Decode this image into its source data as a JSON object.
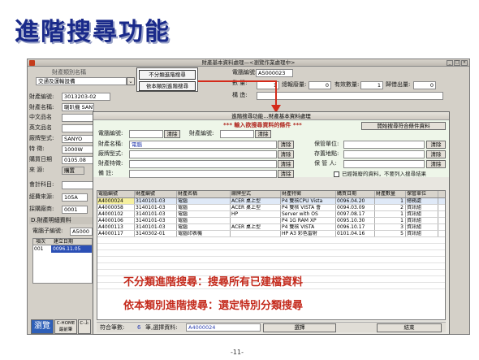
{
  "slide": {
    "title": "進階搜尋功能",
    "page_number": "-11-"
  },
  "back_window": {
    "title": "財產基本資料處理—<瀏覽作業處理中>",
    "category_label": "財產類別名稱",
    "category_value": "交通及運輸設備",
    "popup_options": [
      "不分類進階搜尋",
      "依本類別進階搜尋"
    ],
    "computer_no_label": "電腦編號:",
    "computer_no_value": "A5000023",
    "qty_label": "數 量:",
    "qty_value": "1",
    "total_qty_label": "總報廢量:",
    "total_qty_value": "0",
    "valid_qty_label": "有效數量:",
    "valid_qty_value": "1",
    "returned_label": "歸借出量:",
    "returned_value": "0",
    "build_label": "構 造:",
    "asset_no_label": "財產編號:",
    "asset_no_value": "3013203-02",
    "asset_name_label": "財產名稱:",
    "asset_name_value": "喇叭機 SANYO 1000W",
    "cn_name_label": "中文品名",
    "en_name_label": "英文品名",
    "brand_label": "廠牌型式:",
    "brand_value": "SANYO",
    "spec_label": "特 徵:",
    "spec_value": "1000W",
    "buy_date_label": "購買日期",
    "buy_date_value": "0105.08",
    "source_label": "來 源:",
    "source_value": "購置",
    "accounting_label": "會計科目:",
    "fund_label": "經費來源:",
    "fund_value": "105A",
    "vendor_label": "採購廠商:",
    "vendor_value": "0001",
    "detail_section": "D.財產明細資料",
    "sub_no_label": "電腦子編號:",
    "sub_no_value": "A5000",
    "mini_headers": [
      "項次",
      "建立日期"
    ],
    "mini_row": [
      "001",
      "0096.11.05"
    ],
    "bottom_buttons": [
      "瀏覽",
      "C-HOME 最前筆",
      "C-上"
    ]
  },
  "dialog": {
    "title": "進階搜尋功能…財產基本資料處理",
    "hint": "*** 輸入欲搜尋資料的條件 ***",
    "start_search_button": "開始搜尋符合條件資料",
    "fields": {
      "computer_no": "電腦編號:",
      "asset_no": "財產編號:",
      "asset_name": "財產名稱:",
      "asset_name_value": "電腦",
      "brand": "廠牌型式:",
      "spec": "財產特徵:",
      "remark": "備 註:",
      "storage_unit": "保管單位:",
      "storage_place": "存置地點:",
      "keeper": "保 管 人:"
    },
    "clear_label": "清除",
    "scrapped_checkbox": "已經報廢的資料，不要列入搜尋結果",
    "columns": [
      "電腦編號",
      "財產編號",
      "財產名稱",
      "廠牌型式",
      "財產特徵",
      "購買日期",
      "財產數量",
      "保管單位"
    ],
    "rows": [
      [
        "A4000024",
        "3140101-03",
        "電腦",
        "ACER 桌上型",
        "P4 雙核CPU Vista",
        "0096.04.20",
        "1",
        "總務處"
      ],
      [
        "A4000058",
        "3140101-03",
        "電腦",
        "ACER 桌上型",
        "P4 雙核 VISTA 會",
        "0094.03.09",
        "2",
        "資訊組"
      ],
      [
        "A4000102",
        "3140101-03",
        "電腦",
        "HP",
        "Server with OS",
        "0097.08.17",
        "1",
        "資訊組"
      ],
      [
        "A4000106",
        "3140101-03",
        "電腦",
        "",
        "P4 1G RAM XP",
        "0095.10.30",
        "1",
        "資訊組"
      ],
      [
        "A4000113",
        "3140101-03",
        "電腦",
        "ACER 桌上型",
        "P4 雙核 VISTA",
        "0096.10.17",
        "3",
        "資訊組"
      ],
      [
        "A4000117",
        "3140302-01",
        "電腦印表機",
        "",
        "HP A3 彩色雷射",
        "0101.04.16",
        "5",
        "資訊組"
      ]
    ],
    "status": {
      "count_label": "符合筆數:",
      "count_value": "6",
      "selected_label": "筆,選擇資料:",
      "selected_value": "A4000024",
      "select_button": "選擇",
      "close_button": "結束"
    }
  },
  "annotations": [
    "不分類進階搜尋：搜尋所有已建檔資料",
    "依本類別進階搜尋：選定特別分類搜尋"
  ],
  "colors": {
    "title": "#1a2a8a",
    "annotation": "#c42a1c",
    "hint": "#b0261e",
    "arrow": "#d42a1a"
  }
}
